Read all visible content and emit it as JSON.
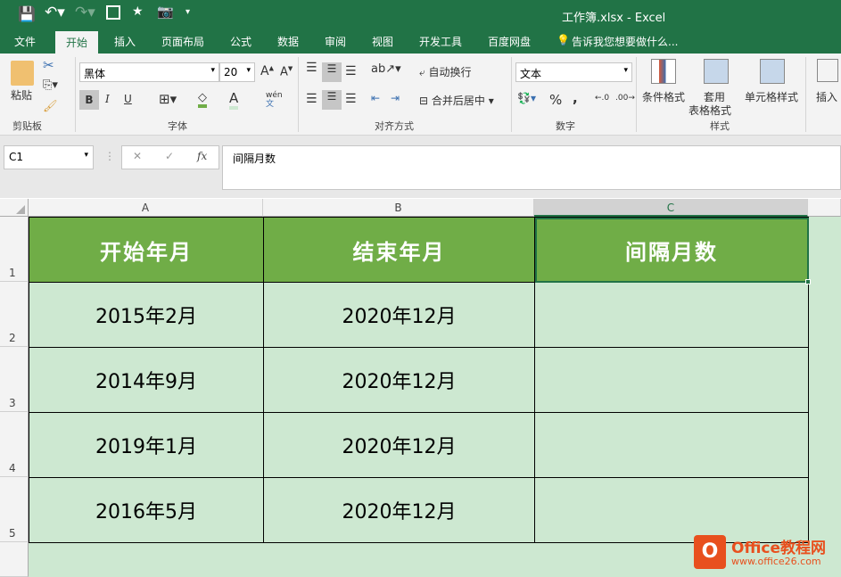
{
  "title": "工作簿.xlsx - Excel",
  "qat": [
    "save-icon",
    "undo-icon",
    "redo-icon",
    "touch-mode-icon",
    "form-icon",
    "camera-icon",
    "customize-icon"
  ],
  "tabs": [
    "文件",
    "开始",
    "插入",
    "页面布局",
    "公式",
    "数据",
    "审阅",
    "视图",
    "开发工具",
    "百度网盘"
  ],
  "tell_me": "告诉我您想要做什么...",
  "ribbon": {
    "clipboard": {
      "paste": "粘贴",
      "group": "剪贴板"
    },
    "font": {
      "name": "黑体",
      "size": "20",
      "bold": "B",
      "italic": "I",
      "underline": "U",
      "group": "字体",
      "phonetic": "wén"
    },
    "alignment": {
      "wrap": "自动换行",
      "merge": "合并后居中",
      "group": "对齐方式"
    },
    "number": {
      "format": "文本",
      "percent": "%",
      "comma": ",",
      "group": "数字"
    },
    "styles": {
      "cond": "条件格式",
      "table1": "套用",
      "table2": "表格格式",
      "cell": "单元格样式",
      "group": "样式"
    },
    "cells": {
      "insert": "插入"
    }
  },
  "formula_bar": {
    "name_box": "C1",
    "fx": "fx",
    "content": "间隔月数"
  },
  "columns": [
    "A",
    "B",
    "C"
  ],
  "rows": [
    "1",
    "2",
    "3",
    "4",
    "5"
  ],
  "table": {
    "headers": [
      "开始年月",
      "结束年月",
      "间隔月数"
    ],
    "data": [
      [
        "2015年2月",
        "2020年12月",
        ""
      ],
      [
        "2014年9月",
        "2020年12月",
        ""
      ],
      [
        "2019年1月",
        "2020年12月",
        ""
      ],
      [
        "2016年5月",
        "2020年12月",
        ""
      ]
    ]
  },
  "watermark": {
    "brand": "Office教程网",
    "url": "www.office26.com"
  },
  "colors": {
    "excel_green": "#217346",
    "header_fill": "#70ad47",
    "cell_fill": "#cde8d1"
  }
}
